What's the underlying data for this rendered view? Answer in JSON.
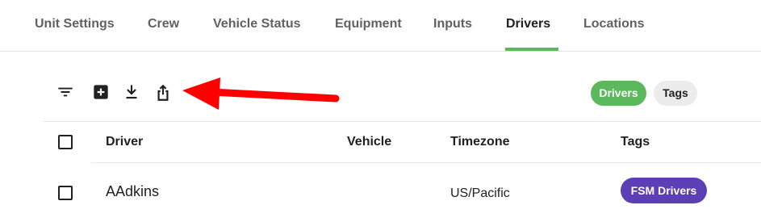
{
  "tabs": [
    {
      "label": "Unit Settings"
    },
    {
      "label": "Crew"
    },
    {
      "label": "Vehicle Status"
    },
    {
      "label": "Equipment"
    },
    {
      "label": "Inputs"
    },
    {
      "label": "Drivers",
      "active": true
    },
    {
      "label": "Locations"
    }
  ],
  "toolbar": {
    "icons": [
      "filter-icon",
      "add-box-icon",
      "download-icon",
      "share-export-icon"
    ],
    "annotation": "red-arrow-pointing-left",
    "accent_color": "#ff0000"
  },
  "view_toggle": {
    "drivers_label": "Drivers",
    "tags_label": "Tags",
    "active_color": "#5cb85c"
  },
  "table": {
    "columns": [
      "Driver",
      "Vehicle",
      "Timezone",
      "Tags"
    ],
    "rows": [
      {
        "driver": "AAdkins",
        "vehicle": "",
        "timezone": "US/Pacific",
        "tag": "FSM Drivers",
        "tag_color": "#5c3fb5"
      }
    ]
  }
}
